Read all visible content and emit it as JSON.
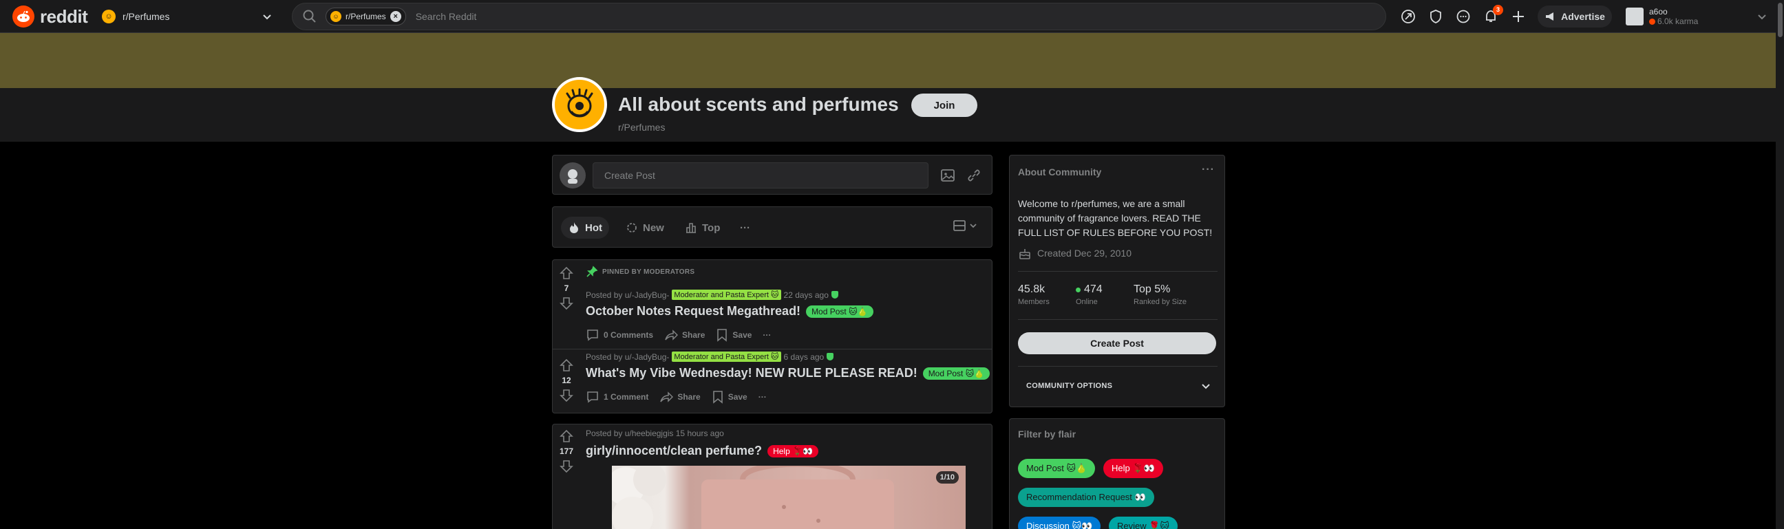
{
  "header": {
    "logo_text": "reddit",
    "community_selector": "r/Perfumes",
    "search": {
      "chip": "r/Perfumes",
      "placeholder": "Search Reddit"
    },
    "notification_count": "3",
    "advertise_label": "Advertise",
    "user": {
      "name": "a6oo",
      "karma": "6.0k karma"
    }
  },
  "community": {
    "title": "All about scents and perfumes",
    "name": "r/Perfumes",
    "join_label": "Join"
  },
  "create_post": {
    "placeholder": "Create Post"
  },
  "sort": {
    "options": [
      "Hot",
      "New",
      "Top"
    ],
    "more": "···"
  },
  "posts": [
    {
      "pinned_label": "PINNED BY MODERATORS",
      "votes": "7",
      "posted_by": "Posted by u/-JadyBug-",
      "user_flair": "Moderator and Pasta Expert 🐱",
      "time": "22 days ago",
      "title": "October Notes Request Megathread!",
      "flair": "Mod Post 🐱🍐",
      "comments": "0 Comments",
      "share": "Share",
      "save": "Save"
    },
    {
      "votes": "12",
      "posted_by": "Posted by u/-JadyBug-",
      "user_flair": "Moderator and Pasta Expert 🐱",
      "time": "6 days ago",
      "title": "What's My Vibe Wednesday! NEW RULE PLEASE READ!",
      "flair": "Mod Post 🐱🍐",
      "comments": "1 Comment",
      "share": "Share",
      "save": "Save"
    },
    {
      "votes": "177",
      "posted_by": "Posted by u/heebiegjgis 15 hours ago",
      "title": "girly/innocent/clean perfume?",
      "flair": "Help 🌹👀",
      "image_counter": "1/10"
    }
  ],
  "about": {
    "heading": "About Community",
    "more": "···",
    "description": "Welcome to r/perfumes, we are a small community of fragrance lovers. READ THE FULL LIST OF RULES BEFORE YOU POST!",
    "created": "Created Dec 29, 2010",
    "stats": [
      {
        "value": "45.8k",
        "label": "Members"
      },
      {
        "value": "474",
        "label": "Online"
      },
      {
        "value": "Top 5%",
        "label": "Ranked by Size"
      }
    ],
    "create_post_label": "Create Post",
    "community_options": "COMMUNITY OPTIONS"
  },
  "filter": {
    "heading": "Filter by flair",
    "flairs": [
      {
        "label": "Mod Post 🐱🍐",
        "color": "#46d160",
        "text_color": "#1a1a1b"
      },
      {
        "label": "Help 🌹👀",
        "color": "#ea0027",
        "text_color": "#ffffff"
      },
      {
        "label": "Recommendation Request 👀",
        "color": "#0aa18f",
        "text_color": "#1a1a1b"
      },
      {
        "label": "Discussion 🐱👀",
        "color": "#0079d3",
        "text_color": "#ffffff"
      },
      {
        "label": "Review 🌹🐱",
        "color": "#00a6a5",
        "text_color": "#1a1a1b"
      }
    ]
  },
  "colors": {
    "brand": "#ff4500",
    "banner": "#60582b",
    "community_icon": "#ffb000"
  }
}
